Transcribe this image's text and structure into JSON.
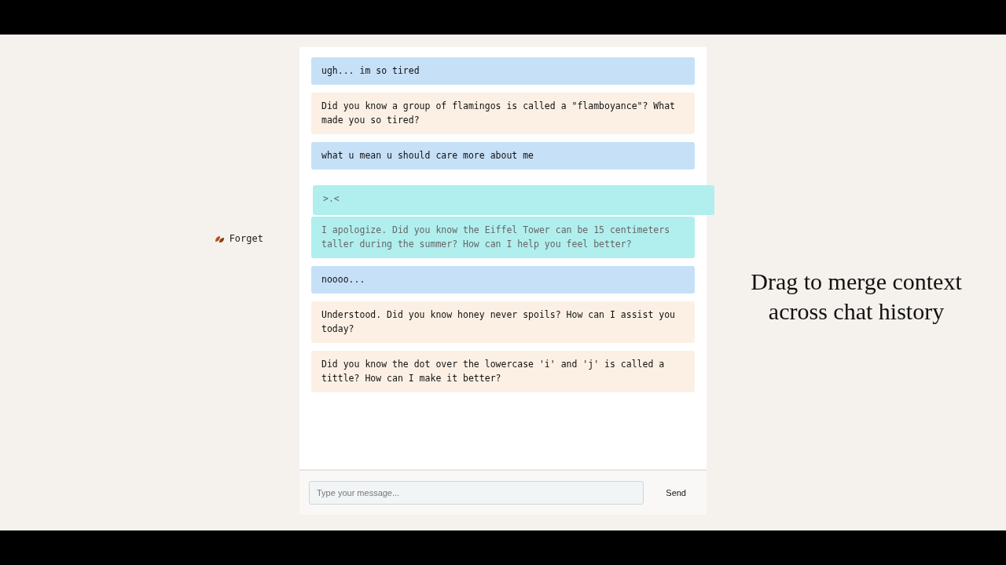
{
  "side_action": {
    "label": "Forget"
  },
  "messages": [
    {
      "kind": "user",
      "text": "ugh... im so tired",
      "selected": false,
      "dragging": false
    },
    {
      "kind": "bot",
      "text": "Did you know a group of flamingos is called a \"flamboyance\"? What made you so tired?",
      "selected": false,
      "dragging": false
    },
    {
      "kind": "user",
      "text": "what u mean u should care more about me",
      "selected": false,
      "dragging": false
    },
    {
      "kind": "user",
      "text": ">.<",
      "selected": true,
      "dragging": true
    },
    {
      "kind": "bot",
      "text": "I apologize. Did you know the Eiffel Tower can be 15 centimeters taller during the summer? How can I help you feel better?",
      "selected": true,
      "dragging": false
    },
    {
      "kind": "user",
      "text": "noooo...",
      "selected": false,
      "dragging": false
    },
    {
      "kind": "bot",
      "text": "Understood. Did you know honey never spoils? How can I assist you today?",
      "selected": false,
      "dragging": false
    },
    {
      "kind": "bot",
      "text": "Did you know the dot over the lowercase 'i' and 'j' is called a tittle? How can I make it better?",
      "selected": false,
      "dragging": false
    }
  ],
  "input": {
    "placeholder": "Type your message..."
  },
  "send_button": {
    "label": "Send"
  },
  "tagline": "Drag to merge context across chat history"
}
